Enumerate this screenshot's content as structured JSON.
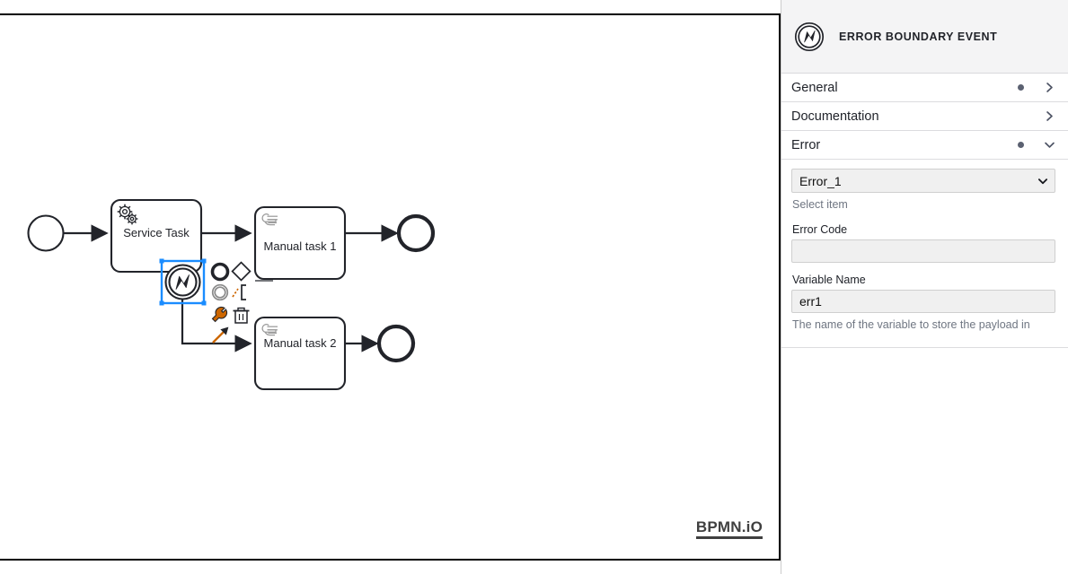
{
  "canvas": {
    "watermark": "BPMN.iO",
    "elements": {
      "start_event": {
        "name": "start-event",
        "label": ""
      },
      "service_task": {
        "label": "Service Task",
        "icon": "service-task-gear-icon"
      },
      "boundary_event": {
        "label": "",
        "icon": "error-event-icon",
        "selected": true
      },
      "manual_task_1": {
        "label": "Manual task 1",
        "icon": "manual-task-hand-icon"
      },
      "manual_task_2": {
        "label": "Manual task 2",
        "icon": "manual-task-hand-icon"
      },
      "end_event_1": {
        "label": ""
      },
      "end_event_2": {
        "label": ""
      }
    },
    "context_pad": [
      {
        "name": "append-end-event-icon",
        "title": "Append EndEvent"
      },
      {
        "name": "append-gateway-icon",
        "title": "Append Gateway"
      },
      {
        "name": "append-task-icon",
        "title": "Append Task"
      },
      {
        "name": "append-intermediate-event-icon",
        "title": "Append Intermediate/Boundary Event"
      },
      {
        "name": "append-text-annotation-icon",
        "title": "Append TextAnnotation"
      },
      {
        "name": "change-type-wrench-icon",
        "title": "Change type"
      },
      {
        "name": "delete-trash-icon",
        "title": "Remove"
      },
      {
        "name": "connect-arrow-icon",
        "title": "Connect"
      }
    ]
  },
  "panel": {
    "header": {
      "title": "ERROR BOUNDARY EVENT",
      "icon": "error-event-icon"
    },
    "groups": [
      {
        "label": "General",
        "has_dot": true,
        "expanded": false,
        "chevron": "chevron-right-icon"
      },
      {
        "label": "Documentation",
        "has_dot": false,
        "expanded": false,
        "chevron": "chevron-right-icon"
      },
      {
        "label": "Error",
        "has_dot": true,
        "expanded": true,
        "chevron": "chevron-down-icon"
      }
    ],
    "error_section": {
      "select": {
        "value": "Error_1",
        "options": [
          "Error_1"
        ],
        "hint": "Select item"
      },
      "error_code": {
        "label": "Error Code",
        "value": "",
        "placeholder": ""
      },
      "variable_name": {
        "label": "Variable Name",
        "value": "err1",
        "placeholder": "",
        "hint": "The name of the variable to store the payload in"
      }
    }
  },
  "colors": {
    "selection_blue": "#1a8cff",
    "context_pad_orange": "#cc6600",
    "panel_header_bg": "#f4f4f5",
    "stroke_black": "#22242a"
  }
}
